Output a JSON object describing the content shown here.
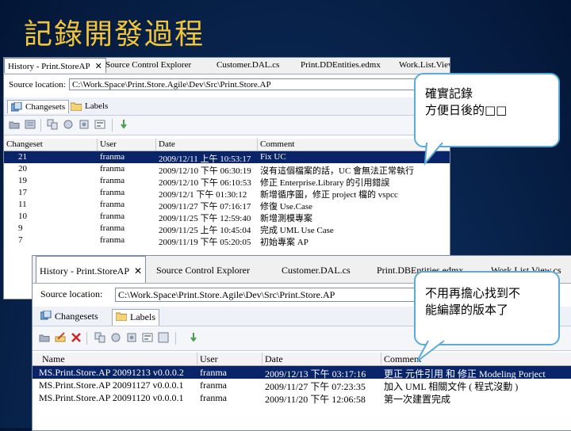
{
  "slide": {
    "title": "記錄開發過程"
  },
  "window1": {
    "tabs": [
      {
        "label": "History - Print.StoreAP",
        "close": "✕",
        "active": true
      },
      {
        "label": "Source Control Explorer"
      },
      {
        "label": "Customer.DAL.cs"
      },
      {
        "label": "Print.DDEntities.edmx"
      },
      {
        "label": "Work.List.View"
      }
    ],
    "source_label": "Source location:",
    "source_path": "C:\\Work.Space\\Print.Store.Agile\\Dev\\Src\\Print.Store.AP",
    "subtabs": [
      {
        "label": "Changesets",
        "icon": "changesets-icon",
        "active": true
      },
      {
        "label": "Labels",
        "icon": "labels-folder-icon"
      }
    ],
    "columns": [
      "Changeset",
      "User",
      "Date",
      "Comment"
    ],
    "rows": [
      [
        "21",
        "franma",
        "2009/12/11 上午 10:53:17",
        "Fix UC"
      ],
      [
        "20",
        "franma",
        "2009/12/10 下午 06:30:19",
        "沒有這個檔案的話，UC 會無法正常執行"
      ],
      [
        "19",
        "franma",
        "2009/12/10 下午 06:10:53",
        "修正 Enterprise.Library 的引用錯誤"
      ],
      [
        "17",
        "franma",
        "2009/12/1 下午 01:30:12",
        "新增循序圖，修正 project 檔的 vspcc"
      ],
      [
        "11",
        "franma",
        "2009/11/27 下午 07:16:17",
        "修復 Use.Case"
      ],
      [
        "10",
        "franma",
        "2009/11/25 下午 12:59:40",
        "新增測模專案"
      ],
      [
        "9",
        "franma",
        "2009/11/25 上午 10:45:04",
        "完成 UML Use Case"
      ],
      [
        "7",
        "franma",
        "2009/11/19 下午 05:20:05",
        "初始專案 AP"
      ]
    ],
    "selected_row": 0
  },
  "window2": {
    "tabs": [
      {
        "label": "History - Print.StoreAP",
        "close": "✕",
        "active": true
      },
      {
        "label": "Source Control Explorer"
      },
      {
        "label": "Customer.DAL.cs"
      },
      {
        "label": "Print.DBEntities.edmx"
      },
      {
        "label": "Work.List.View.cs"
      }
    ],
    "source_label": "Source location:",
    "source_path": "C:\\Work.Space\\Print.Store.Agile\\Dev\\Src\\Print.Store.AP",
    "subtabs": [
      {
        "label": "Changesets",
        "icon": "changesets-icon"
      },
      {
        "label": "Labels",
        "icon": "labels-folder-icon",
        "active": true
      }
    ],
    "columns": [
      "Name",
      "User",
      "Date",
      "Comment"
    ],
    "rows": [
      [
        "MS.Print.Store.AP 20091213 v0.0.0.2",
        "franma",
        "2009/12/13 下午 03:17:16",
        "更正 元件引用 和 修正 Modeling Porject"
      ],
      [
        "MS.Print.Store.AP 20091127 v0.0.0.1",
        "franma",
        "2009/11/27 下午 07:23:35",
        "加入 UML 相關文件 ( 程式沒動 )"
      ],
      [
        "MS.Print.Store.AP 20091120 v0.0.0.1",
        "franma",
        "2009/11/20 下午 12:06:58",
        "第一次建置完成"
      ]
    ],
    "selected_row": 0
  },
  "callouts": {
    "top": {
      "line1": "確實記錄",
      "line2": "方便日後的□□"
    },
    "bottom": {
      "line1": "不用再擔心找到不",
      "line2": "能編譯的版本了"
    }
  },
  "colors": {
    "title": "#f2c53a",
    "selection": "#0a246a",
    "callout_border": "#5aaad8"
  }
}
